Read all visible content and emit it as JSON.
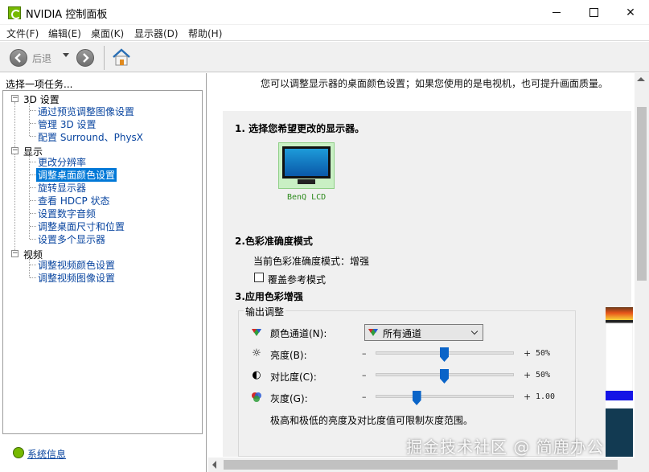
{
  "window": {
    "title": "NVIDIA 控制面板",
    "close_glyph": "✕"
  },
  "menu": [
    "文件(F)",
    "编辑(E)",
    "桌面(K)",
    "显示器(D)",
    "帮助(H)"
  ],
  "toolbar": {
    "back_label": "后退"
  },
  "left": {
    "header": "选择一项任务...",
    "tree": [
      {
        "label": "3D 设置",
        "children": [
          "通过预览调整图像设置",
          "管理 3D 设置",
          "配置 Surround、PhysX"
        ]
      },
      {
        "label": "显示",
        "children": [
          "更改分辨率",
          "调整桌面颜色设置",
          "旋转显示器",
          "查看 HDCP 状态",
          "设置数字音频",
          "调整桌面尺寸和位置",
          "设置多个显示器"
        ]
      },
      {
        "label": "视频",
        "children": [
          "调整视频颜色设置",
          "调整视频图像设置"
        ]
      }
    ],
    "selected_item": "调整桌面颜色设置",
    "system_info": "系统信息"
  },
  "main": {
    "intro": "您可以调整显示器的桌面颜色设置；如果您使用的是电视机，也可提升画面质量。",
    "section1_title": "1. 选择您希望更改的显示器。",
    "monitor_name": "BenQ LCD",
    "section2_title": "2.色彩准确度模式",
    "accuracy_label": "当前色彩准确度模式：增强",
    "override_checkbox": {
      "label": "覆盖参考模式",
      "checked": false
    },
    "section3_title": "3.应用色彩增强",
    "output_group_title": "输出调整",
    "channel": {
      "label": "颜色通道(N):",
      "selected": "所有通道"
    },
    "brightness": {
      "label": "亮度(B):",
      "minus": "–",
      "plus": "+",
      "value_text": "50%",
      "level": 0.5
    },
    "contrast": {
      "label": "对比度(C):",
      "minus": "–",
      "plus": "+",
      "value_text": "50%",
      "level": 0.5
    },
    "gamma": {
      "label": "灰度(G):",
      "minus": "–",
      "plus": "+",
      "value_text": "1.00",
      "level": 0.3
    },
    "hint": "极高和极低的亮度及对比度值可限制灰度范围。"
  },
  "colors": {
    "nvidia_green": "#76b900",
    "link": "#0a46a0",
    "selection": "#0078d7",
    "slider_thumb": "#0a64c8"
  },
  "watermark": "掘金技术社区 @ 简鹿办公"
}
